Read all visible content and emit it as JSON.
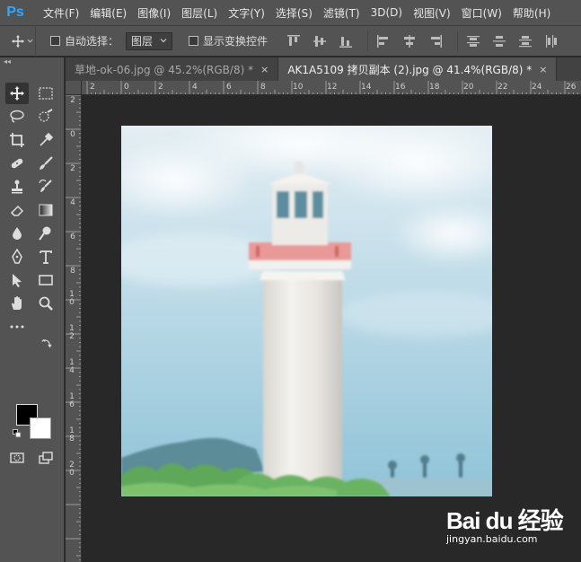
{
  "app": {
    "logo": "Ps"
  },
  "menu": [
    "文件(F)",
    "编辑(E)",
    "图像(I)",
    "图层(L)",
    "文字(Y)",
    "选择(S)",
    "滤镜(T)",
    "3D(D)",
    "视图(V)",
    "窗口(W)",
    "帮助(H)"
  ],
  "options": {
    "auto_select_label": "自动选择：",
    "auto_select_target": "图层",
    "show_transform_label": "显示变换控件"
  },
  "tabs": [
    {
      "label": "草地-ok-06.jpg @ 45.2%(RGB/8) *",
      "close": "×",
      "active": false
    },
    {
      "label": "AK1A5109 拷贝副本 (2).jpg @ 41.4%(RGB/8) *",
      "close": "×",
      "active": true
    }
  ],
  "ruler_top_labels": [
    "2",
    "0",
    "2",
    "4",
    "6",
    "8",
    "10",
    "12",
    "14",
    "16",
    "18",
    "20",
    "22",
    "24",
    "26"
  ],
  "ruler_left_labels": [
    "2",
    "0",
    "2",
    "4",
    "6",
    "8",
    "10",
    "12",
    "14",
    "16",
    "18",
    "20"
  ],
  "colors": {
    "foreground": "#000000",
    "background": "#ffffff",
    "accent": "#31a8ff"
  },
  "toolbar_collapse": "◂◂",
  "watermark": {
    "logo": "Bai du 经验",
    "url": "jingyan.baidu.com"
  }
}
